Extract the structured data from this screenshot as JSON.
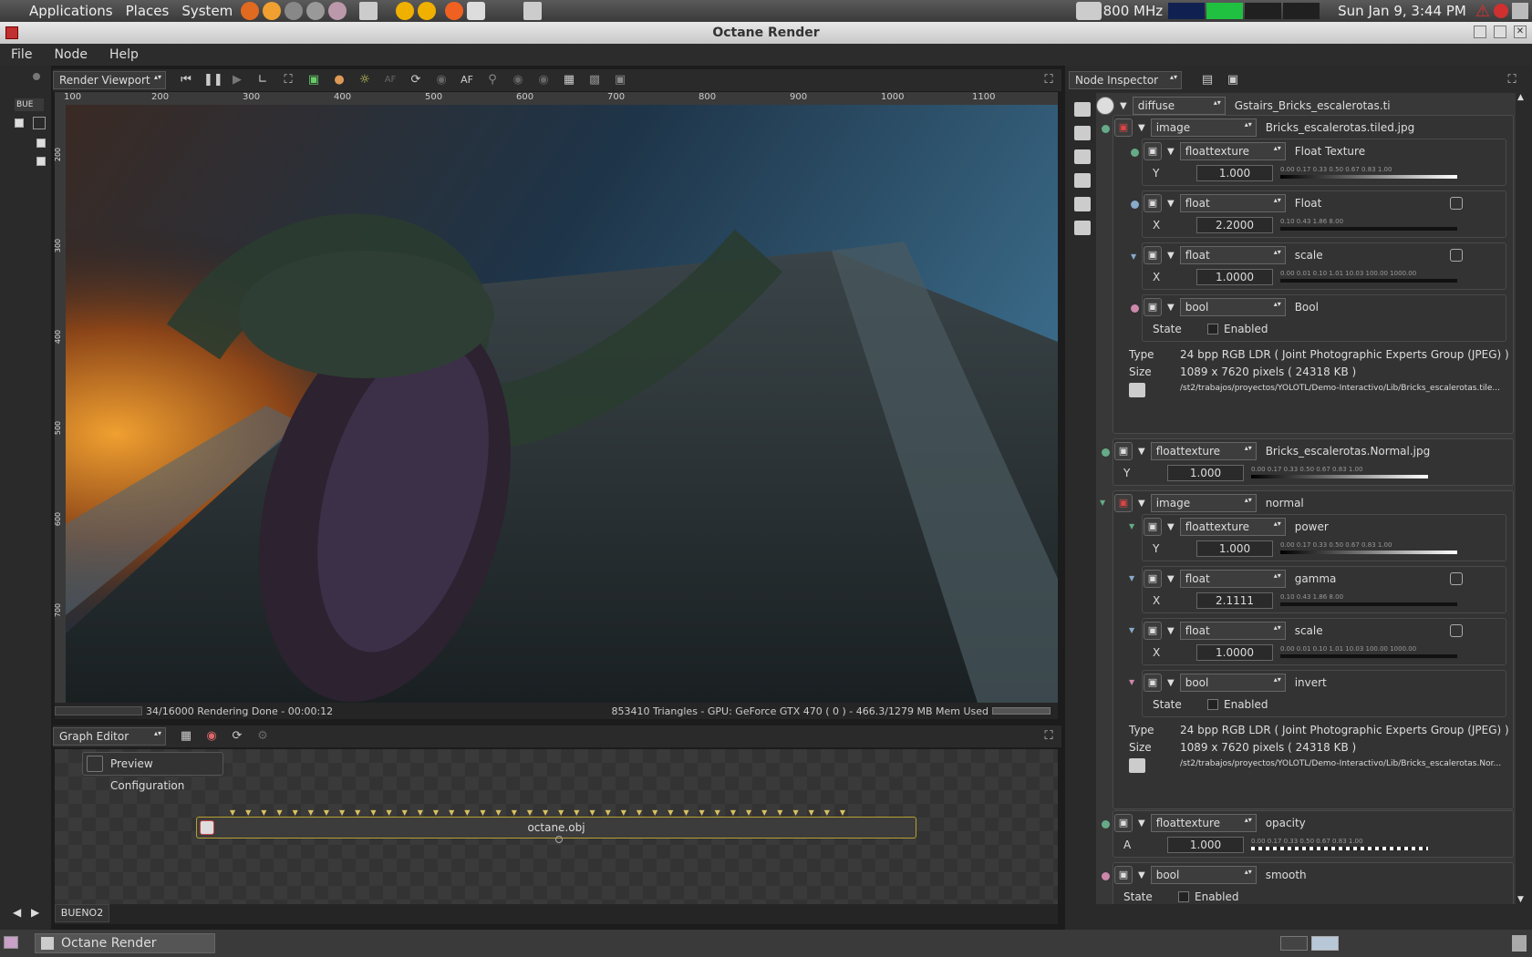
{
  "top_panel": {
    "menus": [
      "Applications",
      "Places",
      "System"
    ],
    "cpu_freq": "800 MHz",
    "datetime": "Sun Jan 9,  3:44 PM"
  },
  "window": {
    "title": "Octane Render"
  },
  "menubar": [
    "File",
    "Node",
    "Help"
  ],
  "left_strip": {
    "label": "BUE"
  },
  "viewport": {
    "mode": "Render Viewport",
    "af_label": "AF",
    "ruler_ticks": [
      "100",
      "200",
      "300",
      "400",
      "500",
      "600",
      "700",
      "800",
      "900",
      "1000",
      "1100"
    ],
    "vruler_ticks": [
      "200",
      "300",
      "400",
      "500",
      "600",
      "700"
    ],
    "status_left": "34/16000 Rendering Done - 00:00:12",
    "status_right": "853410 Triangles - GPU: GeForce GTX 470 ( 0 ) - 466.3/1279 MB Mem Used"
  },
  "graph_editor": {
    "mode": "Graph Editor",
    "preview_button": "Preview Configuration",
    "node_label": "octane.obj",
    "tab": "BUENO2"
  },
  "inspector": {
    "mode": "Node Inspector",
    "root_type": "diffuse",
    "root_name": "Gstairs_Bricks_escalerotas.ti",
    "image1": {
      "type": "image",
      "name": "Bricks_escalerotas.tiled.jpg",
      "power": {
        "type": "floattexture",
        "name": "Float Texture",
        "axis": "Y",
        "value": "1.000",
        "ticks": "0.00  0.17  0.33  0.50  0.67  0.83  1.00"
      },
      "gamma": {
        "type": "float",
        "name": "Float",
        "axis": "X",
        "value": "2.2000",
        "ticks": "0.10        0.43        1.86        8.00"
      },
      "scale": {
        "type": "float",
        "name": "scale",
        "axis": "X",
        "value": "1.0000",
        "ticks": "0.00 0.01  0.10  1.01  10.03 100.00 1000.00"
      },
      "invert": {
        "type": "bool",
        "name": "Bool",
        "state_label": "State",
        "check_label": "Enabled"
      },
      "info_type_label": "Type",
      "info_type": "24 bpp RGB LDR ( Joint Photographic Experts Group (JPEG) )",
      "info_size_label": "Size",
      "info_size": "1089 x 7620 pixels ( 24318 KB )",
      "path": "/st2/trabajos/proyectos/YOLOTL/Demo-Interactivo/Lib/Bricks_escalerotas.tile..."
    },
    "specular": {
      "type": "floattexture",
      "name": "Bricks_escalerotas.Normal.jpg",
      "axis": "Y",
      "value": "1.000",
      "ticks": "0.00  0.17  0.33  0.50  0.67  0.83  1.00"
    },
    "image2": {
      "type": "image",
      "name": "normal",
      "power": {
        "type": "floattexture",
        "name": "power",
        "axis": "Y",
        "value": "1.000",
        "ticks": "0.00  0.17  0.33  0.50  0.67  0.83  1.00"
      },
      "gamma": {
        "type": "float",
        "name": "gamma",
        "axis": "X",
        "value": "2.1111",
        "ticks": "0.10        0.43        1.86        8.00"
      },
      "scale": {
        "type": "float",
        "name": "scale",
        "axis": "X",
        "value": "1.0000",
        "ticks": "0.00 0.01  0.10  1.01  10.03 100.00 1000.00"
      },
      "invert": {
        "type": "bool",
        "name": "invert",
        "state_label": "State",
        "check_label": "Enabled"
      },
      "info_type_label": "Type",
      "info_type": "24 bpp RGB LDR ( Joint Photographic Experts Group (JPEG) )",
      "info_size_label": "Size",
      "info_size": "1089 x 7620 pixels ( 24318 KB )",
      "path": "/st2/trabajos/proyectos/YOLOTL/Demo-Interactivo/Lib/Bricks_escalerotas.Nor..."
    },
    "opacity": {
      "type": "floattexture",
      "name": "opacity",
      "axis": "A",
      "value": "1.000",
      "ticks": "0.00  0.17  0.33  0.50  0.67  0.83  1.00"
    },
    "smooth": {
      "type": "bool",
      "name": "smooth",
      "state_label": "State",
      "check_label": "Enabled"
    }
  },
  "taskbar": {
    "item": "Octane Render"
  }
}
